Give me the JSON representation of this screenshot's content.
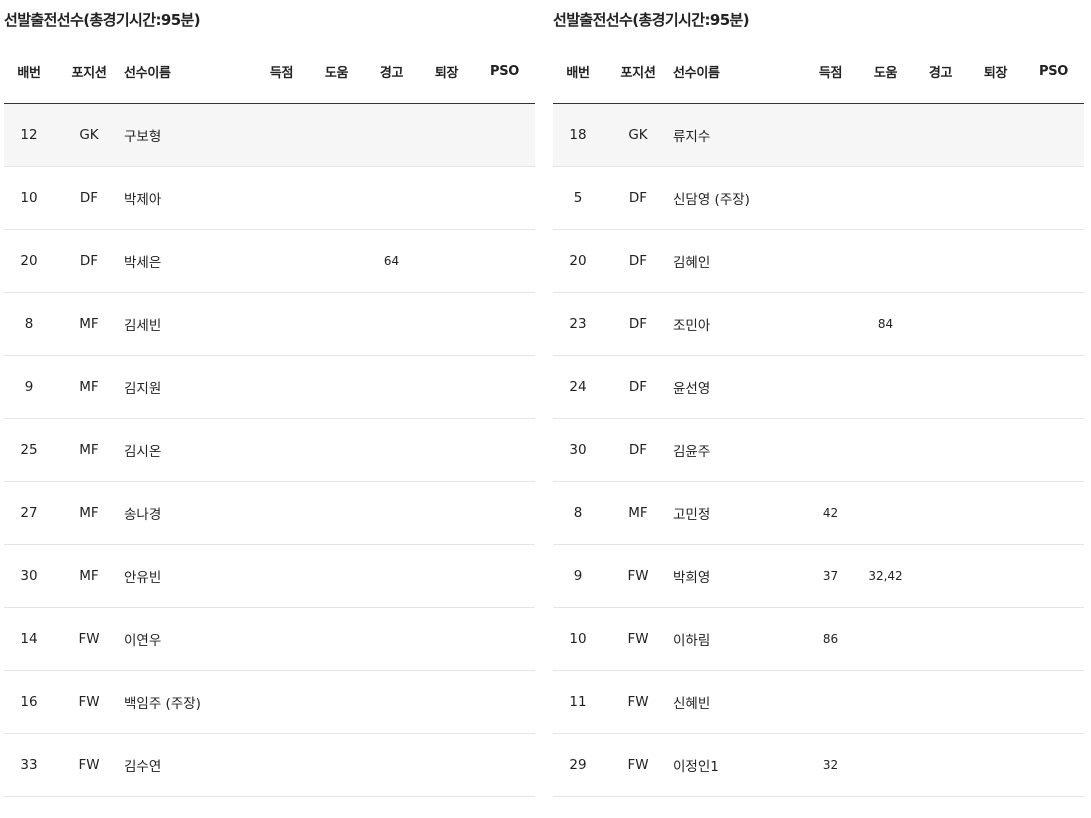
{
  "left": {
    "title": "선발출전선수(총경기시간:95분)",
    "headers": [
      "배번",
      "포지션",
      "선수이름",
      "득점",
      "도움",
      "경고",
      "퇴장",
      "PSO"
    ],
    "rows": [
      {
        "no": "12",
        "pos": "GK",
        "name": "구보형",
        "goal": "",
        "assist": "",
        "warn": "",
        "exit": "",
        "pso": ""
      },
      {
        "no": "10",
        "pos": "DF",
        "name": "박제아",
        "goal": "",
        "assist": "",
        "warn": "",
        "exit": "",
        "pso": ""
      },
      {
        "no": "20",
        "pos": "DF",
        "name": "박세은",
        "goal": "",
        "assist": "",
        "warn": "64",
        "exit": "",
        "pso": ""
      },
      {
        "no": "8",
        "pos": "MF",
        "name": "김세빈",
        "goal": "",
        "assist": "",
        "warn": "",
        "exit": "",
        "pso": ""
      },
      {
        "no": "9",
        "pos": "MF",
        "name": "김지원",
        "goal": "",
        "assist": "",
        "warn": "",
        "exit": "",
        "pso": ""
      },
      {
        "no": "25",
        "pos": "MF",
        "name": "김시온",
        "goal": "",
        "assist": "",
        "warn": "",
        "exit": "",
        "pso": ""
      },
      {
        "no": "27",
        "pos": "MF",
        "name": "송나경",
        "goal": "",
        "assist": "",
        "warn": "",
        "exit": "",
        "pso": ""
      },
      {
        "no": "30",
        "pos": "MF",
        "name": "안유빈",
        "goal": "",
        "assist": "",
        "warn": "",
        "exit": "",
        "pso": ""
      },
      {
        "no": "14",
        "pos": "FW",
        "name": "이연우",
        "goal": "",
        "assist": "",
        "warn": "",
        "exit": "",
        "pso": ""
      },
      {
        "no": "16",
        "pos": "FW",
        "name": "백임주 (주장)",
        "goal": "",
        "assist": "",
        "warn": "",
        "exit": "",
        "pso": ""
      },
      {
        "no": "33",
        "pos": "FW",
        "name": "김수연",
        "goal": "",
        "assist": "",
        "warn": "",
        "exit": "",
        "pso": ""
      }
    ]
  },
  "right": {
    "title": "선발출전선수(총경기시간:95분)",
    "headers": [
      "배번",
      "포지션",
      "선수이름",
      "득점",
      "도움",
      "경고",
      "퇴장",
      "PSO"
    ],
    "rows": [
      {
        "no": "18",
        "pos": "GK",
        "name": "류지수",
        "goal": "",
        "assist": "",
        "warn": "",
        "exit": "",
        "pso": ""
      },
      {
        "no": "5",
        "pos": "DF",
        "name": "신담영 (주장)",
        "goal": "",
        "assist": "",
        "warn": "",
        "exit": "",
        "pso": ""
      },
      {
        "no": "20",
        "pos": "DF",
        "name": "김혜인",
        "goal": "",
        "assist": "",
        "warn": "",
        "exit": "",
        "pso": ""
      },
      {
        "no": "23",
        "pos": "DF",
        "name": "조민아",
        "goal": "",
        "assist": "84",
        "warn": "",
        "exit": "",
        "pso": ""
      },
      {
        "no": "24",
        "pos": "DF",
        "name": "윤선영",
        "goal": "",
        "assist": "",
        "warn": "",
        "exit": "",
        "pso": ""
      },
      {
        "no": "30",
        "pos": "DF",
        "name": "김윤주",
        "goal": "",
        "assist": "",
        "warn": "",
        "exit": "",
        "pso": ""
      },
      {
        "no": "8",
        "pos": "MF",
        "name": "고민정",
        "goal": "42",
        "assist": "",
        "warn": "",
        "exit": "",
        "pso": ""
      },
      {
        "no": "9",
        "pos": "FW",
        "name": "박희영",
        "goal": "37",
        "assist": "32,42",
        "warn": "",
        "exit": "",
        "pso": ""
      },
      {
        "no": "10",
        "pos": "FW",
        "name": "이하림",
        "goal": "86",
        "assist": "",
        "warn": "",
        "exit": "",
        "pso": ""
      },
      {
        "no": "11",
        "pos": "FW",
        "name": "신혜빈",
        "goal": "",
        "assist": "",
        "warn": "",
        "exit": "",
        "pso": ""
      },
      {
        "no": "29",
        "pos": "FW",
        "name": "이정인1",
        "goal": "32",
        "assist": "",
        "warn": "",
        "exit": "",
        "pso": ""
      }
    ]
  }
}
